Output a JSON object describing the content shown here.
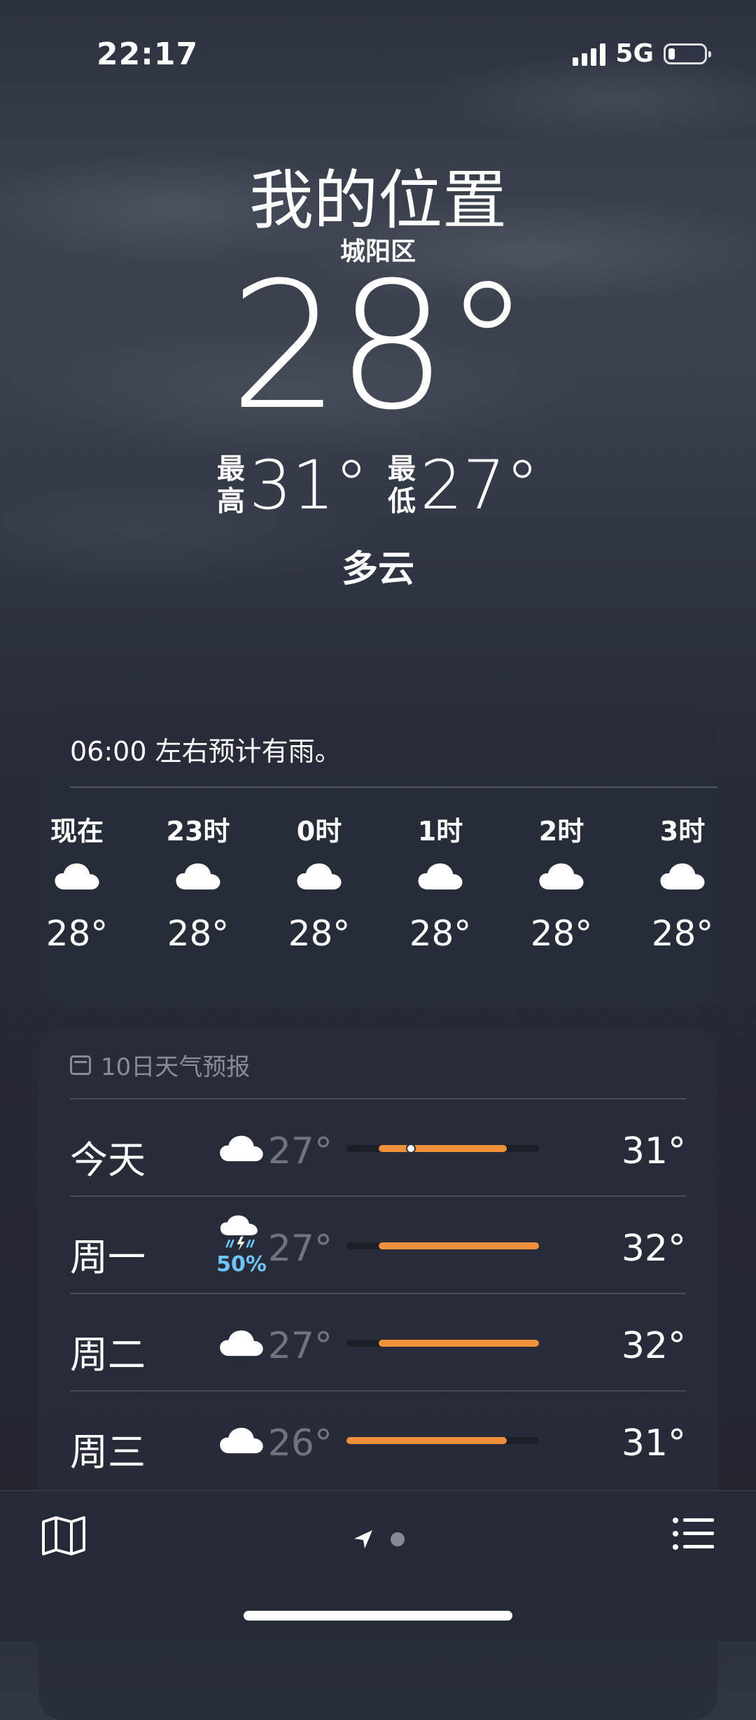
{
  "status": {
    "time": "22:17",
    "network": "5G"
  },
  "header": {
    "title": "我的位置",
    "subtitle": "城阳区",
    "temp": "28°",
    "high_label_1": "最",
    "high_label_2": "高",
    "high": "31°",
    "low_label_1": "最",
    "low_label_2": "低",
    "low": "27°",
    "condition": "多云"
  },
  "hourly": {
    "note": "06:00 左右预计有雨。",
    "items": [
      {
        "label": "现在",
        "icon": "cloud-icon",
        "temp": "28°"
      },
      {
        "label": "23时",
        "icon": "cloud-icon",
        "temp": "28°"
      },
      {
        "label": "0时",
        "icon": "cloud-icon",
        "temp": "28°"
      },
      {
        "label": "1时",
        "icon": "cloud-icon",
        "temp": "28°"
      },
      {
        "label": "2时",
        "icon": "cloud-icon",
        "temp": "28°"
      },
      {
        "label": "3时",
        "icon": "cloud-icon",
        "temp": "28°"
      }
    ]
  },
  "daily": {
    "title": "10日天气预报",
    "range_min": 26,
    "range_max": 32,
    "current_temp": 28,
    "items": [
      {
        "day": "今天",
        "icon": "cloud-icon",
        "low": "27°",
        "high": "31°",
        "low_val": 27,
        "high_val": 31,
        "show_current": true
      },
      {
        "day": "周一",
        "icon": "thunderstorm-rain-icon",
        "pop": "50%",
        "low": "27°",
        "high": "32°",
        "low_val": 27,
        "high_val": 32
      },
      {
        "day": "周二",
        "icon": "cloud-icon",
        "low": "27°",
        "high": "32°",
        "low_val": 27,
        "high_val": 32
      },
      {
        "day": "周三",
        "icon": "cloud-icon",
        "low": "26°",
        "high": "31°",
        "low_val": 26,
        "high_val": 31
      }
    ]
  },
  "colors": {
    "accent": "#f0903a",
    "precip": "#6fc3ff"
  },
  "toolbar": {
    "map_icon": "map-icon",
    "location_icon": "location-arrow-icon",
    "list_icon": "list-icon"
  }
}
